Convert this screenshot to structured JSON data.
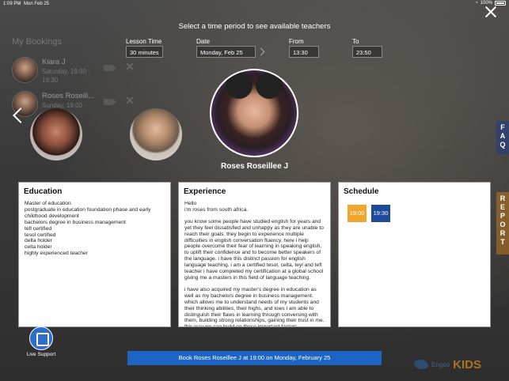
{
  "status_bar": {
    "time": "1:09 PM",
    "date": "Mon Feb 25",
    "battery": "100%"
  },
  "heading": "Select a time period to see available teachers",
  "bookings": {
    "title": "My Bookings",
    "items": [
      {
        "name": "Kiara J",
        "when": "Saturday, 19:00 - 19:30"
      },
      {
        "name": "Roses Roseill...",
        "when": "Sunday, 19:00 - 19:30"
      }
    ]
  },
  "filters": {
    "lesson_time": {
      "label": "Lesson Time",
      "value": "30 minutes"
    },
    "date": {
      "label": "Date",
      "value": "Monday, Feb 25"
    },
    "from": {
      "label": "From",
      "value": "13:30"
    },
    "to": {
      "label": "To",
      "value": "23:50"
    }
  },
  "teacher": {
    "name": "Roses Roseillee J"
  },
  "education": {
    "title": "Education",
    "lines": [
      "Master of education",
      "postgraduate in education foundation phase and early childhood development",
      "bachelors degree in business management",
      "tefl certified",
      "tesol certified",
      "delta holder",
      "celta holder",
      "highly experienced teacher"
    ]
  },
  "experience": {
    "title": "Experience",
    "paragraphs": [
      "Hello\ni'm roses from south africa.",
      "you know some people have studied english for years and yet they feel dissatisfied and unhappy as they are unable to reach their goals. they begin to experience multiple difficulties in english conversation fluency. here i help people overcome their fear of learning in speaking english, to uplift their confidence and to become better speakers of the language. i have this distinct passion for english language teaching. i am a certified tesol, celta, teyl and tefl teacher i have completed my certification at a global school giving me a masters in this field of language teaching.",
      "i have also acquired my master's degree in education as well as my bachelors degree in business management. which allows me to understand needs of my students and their thinking abilities, their highs, and lows i am able to distinguish their flaws in learning through conversing with them, building strong relationships, gaining their trust in me. this way we can build on these important factors"
    ]
  },
  "schedule": {
    "title": "Schedule",
    "slots": [
      {
        "time": "19:00",
        "color": "#f0a52c"
      },
      {
        "time": "19:30",
        "color": "#1e4a9a"
      }
    ]
  },
  "side_tabs": {
    "faq": "F A Q",
    "report": "R E P O R T"
  },
  "support": {
    "label": "Live Support"
  },
  "book_button": "Book Roses Roseillee J at 19:00 on Monday, February 25",
  "brand": {
    "text": "Engoo",
    "kids": "KIDS"
  }
}
